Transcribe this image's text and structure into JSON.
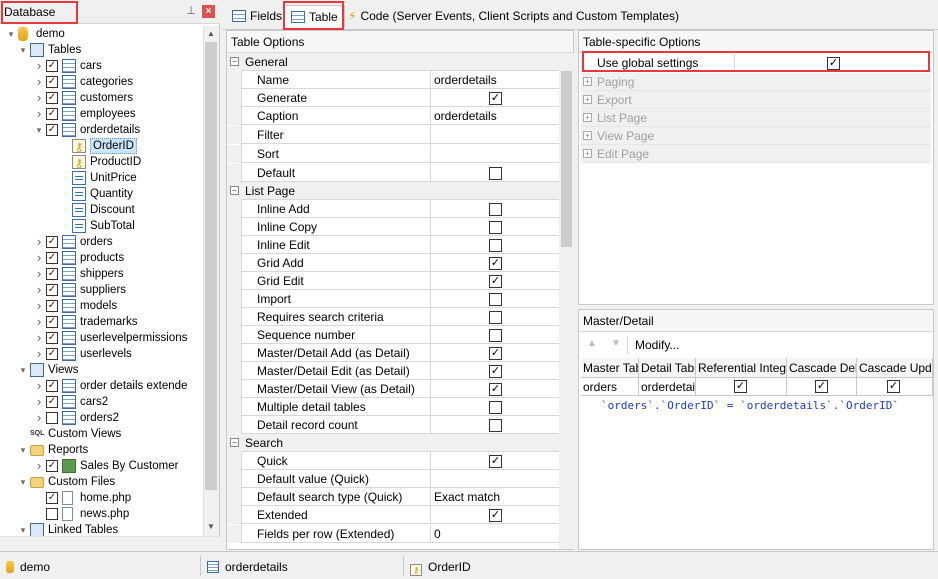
{
  "left_panel": {
    "title": "Database",
    "tree": [
      {
        "label": "demo",
        "icon": "database-icon",
        "level": 0,
        "toggle": "v",
        "check": null
      },
      {
        "label": "Tables",
        "icon": "tables-icon",
        "level": 1,
        "toggle": "v",
        "check": null
      },
      {
        "label": "cars",
        "icon": "table-icon",
        "level": 2,
        "toggle": ">",
        "check": true
      },
      {
        "label": "categories",
        "icon": "table-icon",
        "level": 2,
        "toggle": ">",
        "check": true
      },
      {
        "label": "customers",
        "icon": "table-icon",
        "level": 2,
        "toggle": ">",
        "check": true
      },
      {
        "label": "employees",
        "icon": "table-icon",
        "level": 2,
        "toggle": ">",
        "check": true
      },
      {
        "label": "orderdetails",
        "icon": "table-icon",
        "level": 2,
        "toggle": "v",
        "check": true
      },
      {
        "label": "OrderID",
        "icon": "key-icon",
        "level": 3,
        "toggle": "",
        "check": null,
        "selected": true
      },
      {
        "label": "ProductID",
        "icon": "key-icon",
        "level": 3,
        "toggle": "",
        "check": null
      },
      {
        "label": "UnitPrice",
        "icon": "field-icon",
        "level": 3,
        "toggle": "",
        "check": null
      },
      {
        "label": "Quantity",
        "icon": "field-icon",
        "level": 3,
        "toggle": "",
        "check": null
      },
      {
        "label": "Discount",
        "icon": "field-icon",
        "level": 3,
        "toggle": "",
        "check": null
      },
      {
        "label": "SubTotal",
        "icon": "field-icon",
        "level": 3,
        "toggle": "",
        "check": null
      },
      {
        "label": "orders",
        "icon": "table-icon",
        "level": 2,
        "toggle": ">",
        "check": true
      },
      {
        "label": "products",
        "icon": "table-icon",
        "level": 2,
        "toggle": ">",
        "check": true
      },
      {
        "label": "shippers",
        "icon": "table-icon",
        "level": 2,
        "toggle": ">",
        "check": true
      },
      {
        "label": "suppliers",
        "icon": "table-icon",
        "level": 2,
        "toggle": ">",
        "check": true
      },
      {
        "label": "models",
        "icon": "table-icon",
        "level": 2,
        "toggle": ">",
        "check": true
      },
      {
        "label": "trademarks",
        "icon": "table-icon",
        "level": 2,
        "toggle": ">",
        "check": true
      },
      {
        "label": "userlevelpermissions",
        "icon": "table-icon",
        "level": 2,
        "toggle": ">",
        "check": true
      },
      {
        "label": "userlevels",
        "icon": "table-icon",
        "level": 2,
        "toggle": ">",
        "check": true
      },
      {
        "label": "Views",
        "icon": "tables-icon",
        "level": 1,
        "toggle": "v",
        "check": null
      },
      {
        "label": "order details extende",
        "icon": "table-icon",
        "level": 2,
        "toggle": ">",
        "check": true
      },
      {
        "label": "cars2",
        "icon": "table-icon",
        "level": 2,
        "toggle": ">",
        "check": true
      },
      {
        "label": "orders2",
        "icon": "table-icon",
        "level": 2,
        "toggle": ">",
        "check": false
      },
      {
        "label": "Custom Views",
        "icon": "sql-icon",
        "level": 1,
        "toggle": "",
        "check": null
      },
      {
        "label": "Reports",
        "icon": "folder-icon",
        "level": 1,
        "toggle": "v",
        "check": null
      },
      {
        "label": "Sales By Customer",
        "icon": "report-icon",
        "level": 2,
        "toggle": ">",
        "check": true
      },
      {
        "label": "Custom Files",
        "icon": "folder-icon",
        "level": 1,
        "toggle": "v",
        "check": null
      },
      {
        "label": "home.php",
        "icon": "file-icon",
        "level": 2,
        "toggle": "",
        "check": true
      },
      {
        "label": "news.php",
        "icon": "file-icon",
        "level": 2,
        "toggle": "",
        "check": false
      },
      {
        "label": "Linked Tables",
        "icon": "tables-icon",
        "level": 1,
        "toggle": "v",
        "check": null
      }
    ]
  },
  "tabs": {
    "fields": "Fields",
    "table": "Table",
    "code": "Code (Server Events, Client Scripts and Custom Templates)"
  },
  "table_options": {
    "title": "Table Options",
    "rows": [
      {
        "type": "cat",
        "name": "General"
      },
      {
        "name": "Name",
        "value": "orderdetails"
      },
      {
        "name": "Generate",
        "check": true
      },
      {
        "name": "Caption",
        "value": "orderdetails"
      },
      {
        "name": "Filter",
        "value": ""
      },
      {
        "name": "Sort",
        "value": ""
      },
      {
        "name": "Default",
        "check": false
      },
      {
        "type": "cat",
        "name": "List Page"
      },
      {
        "name": "Inline Add",
        "check": false
      },
      {
        "name": "Inline Copy",
        "check": false
      },
      {
        "name": "Inline Edit",
        "check": false
      },
      {
        "name": "Grid Add",
        "check": true
      },
      {
        "name": "Grid Edit",
        "check": true
      },
      {
        "name": "Import",
        "check": false
      },
      {
        "name": "Requires search criteria",
        "check": false
      },
      {
        "name": "Sequence number",
        "check": false
      },
      {
        "name": "Master/Detail Add (as Detail)",
        "check": true
      },
      {
        "name": "Master/Detail Edit (as Detail)",
        "check": true
      },
      {
        "name": "Master/Detail View (as Detail)",
        "check": true
      },
      {
        "name": "Multiple detail tables",
        "check": false
      },
      {
        "name": "Detail record count",
        "check": false
      },
      {
        "type": "cat",
        "name": "Search"
      },
      {
        "name": "Quick",
        "check": true
      },
      {
        "name": "Default value (Quick)",
        "value": ""
      },
      {
        "name": "Default search type (Quick)",
        "value": "Exact match"
      },
      {
        "name": "Extended",
        "check": true
      },
      {
        "name": "Fields per row (Extended)",
        "value": "0"
      }
    ]
  },
  "table_specific": {
    "title": "Table-specific Options",
    "use_global_label": "Use global settings",
    "use_global_checked": true,
    "sections": [
      "Paging",
      "Export",
      "List Page",
      "View Page",
      "Edit Page"
    ]
  },
  "master_detail": {
    "title": "Master/Detail",
    "modify_label": "Modify...",
    "columns": [
      "Master Tab",
      "Detail Tabl",
      "Referential Integr",
      "Cascade Dele",
      "Cascade Updat"
    ],
    "row": {
      "master": "orders",
      "detail": "orderdetai",
      "ri": true,
      "cd": true,
      "cu": true
    },
    "expression": "`orders`.`OrderID` = `orderdetails`.`OrderID`"
  },
  "status": {
    "database": "demo",
    "table": "orderdetails",
    "field": "OrderID"
  },
  "colors": {
    "highlight_red": "#e8383d",
    "expression_blue": "#1a3fcc"
  }
}
